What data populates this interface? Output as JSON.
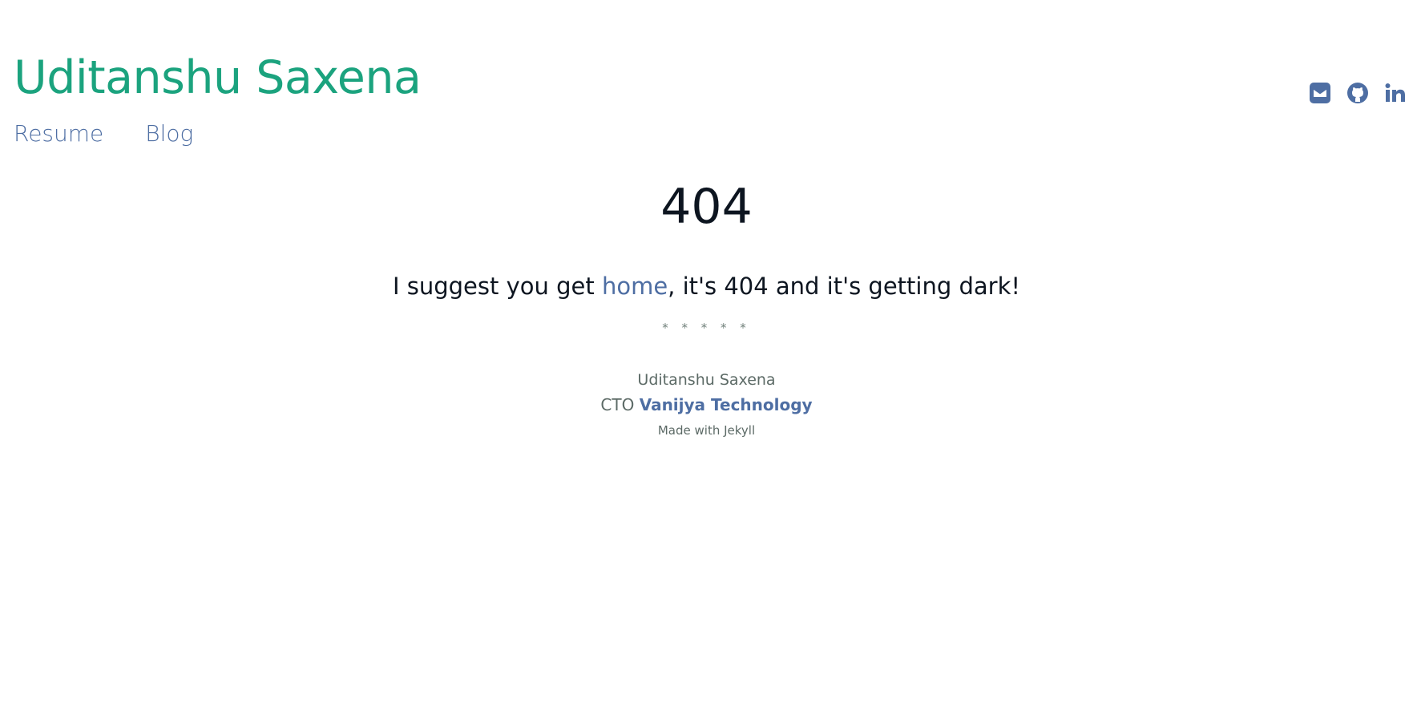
{
  "colors": {
    "brand": "#1ba37e",
    "link": "#4e6ea3",
    "text_dark": "#0d1520",
    "muted": "#5c6a66"
  },
  "header": {
    "site_title": "Uditanshu Saxena",
    "nav": [
      {
        "label": "Resume"
      },
      {
        "label": "Blog"
      }
    ],
    "social": [
      {
        "icon": "envelope-square-icon"
      },
      {
        "icon": "github-icon"
      },
      {
        "icon": "linkedin-icon"
      }
    ]
  },
  "main": {
    "error_code": "404",
    "message_prefix": "I suggest you get ",
    "message_link": "home",
    "message_suffix": ", it's 404 and it's getting dark!",
    "divider": "* * * * *"
  },
  "footer": {
    "name": "Uditanshu Saxena",
    "role_prefix": "CTO ",
    "company": "Vanijya Technology",
    "made_with": "Made with Jekyll"
  }
}
